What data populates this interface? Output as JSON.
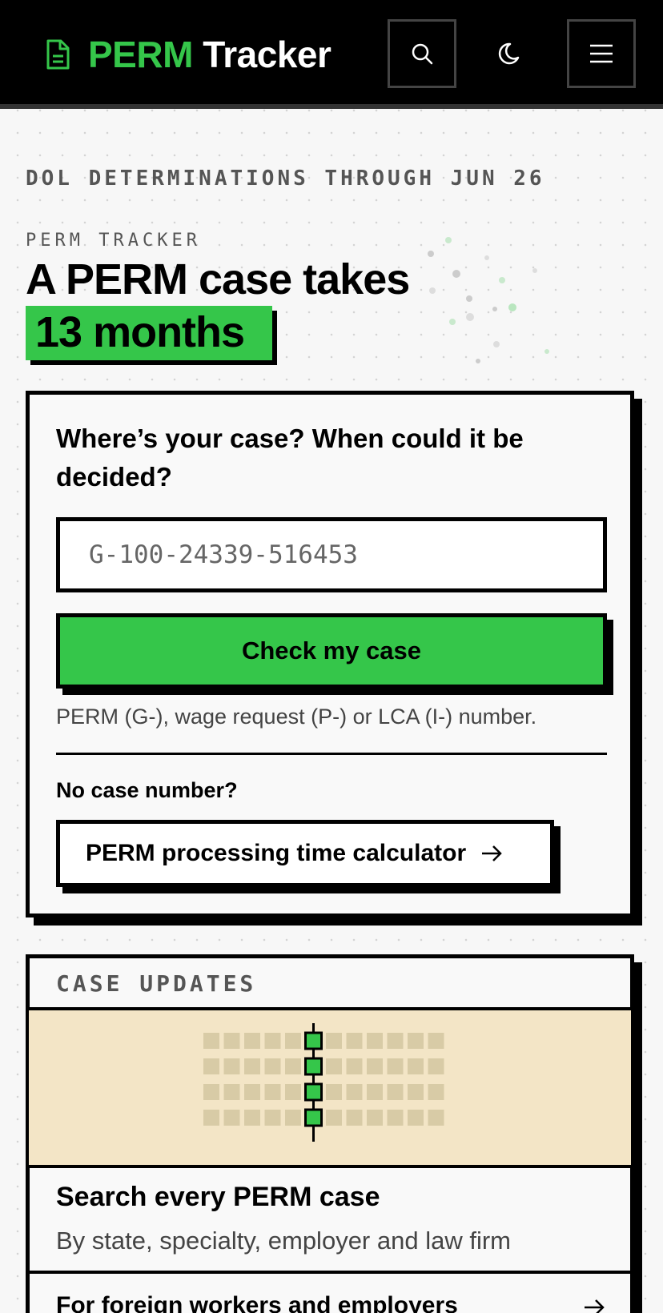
{
  "header": {
    "brand_part1": "PERM",
    "brand_part2": "Tracker",
    "icons": [
      "document-icon",
      "search-icon",
      "moon-icon",
      "menu-icon"
    ]
  },
  "hero": {
    "date_line": "DOL DETERMINATIONS THROUGH JUN 26",
    "kicker": "PERM TRACKER",
    "headline": "A PERM case takes",
    "highlight": "13 months"
  },
  "lookup": {
    "title": "Where’s your case? When could it be decided?",
    "input_placeholder": "G-100-24339-516453",
    "button_label": "Check my case",
    "helper_text": "PERM (G-), wage request (P-) or LCA (I-) number.",
    "no_case_label": "No case number?",
    "calculator_label": "PERM processing time calculator"
  },
  "updates": {
    "label": "CASE UPDATES",
    "search_title": "Search every PERM case",
    "search_subtitle": "By state, specialty, employer and law firm",
    "row2_label": "For foreign workers and employers"
  },
  "colors": {
    "accent": "#35c64a",
    "header_bg": "#000000",
    "graphic_bg": "#f3e5c6",
    "page_bg": "#f7f7f7"
  }
}
